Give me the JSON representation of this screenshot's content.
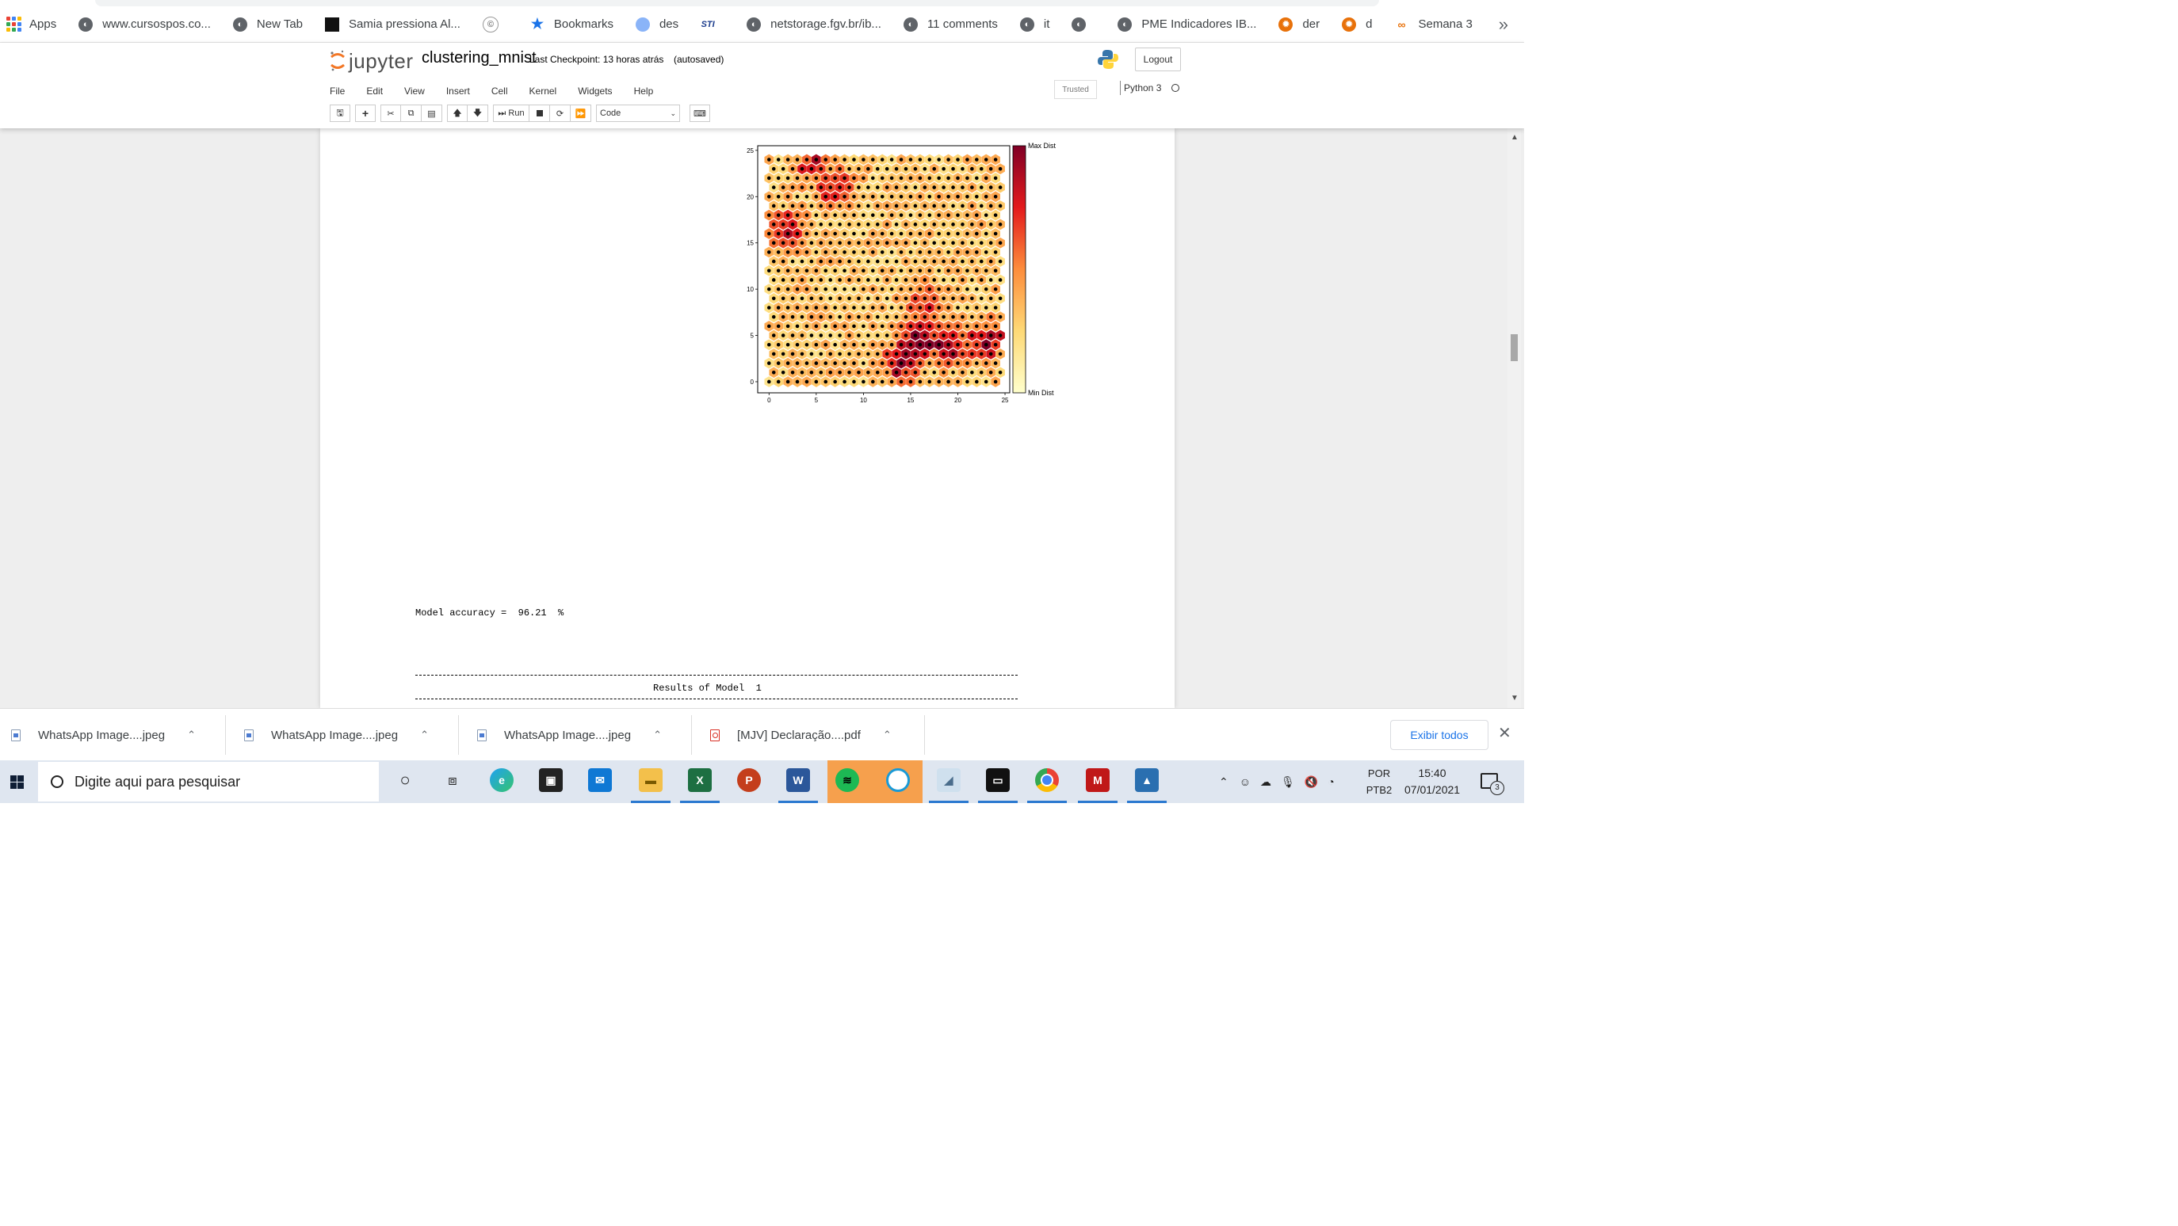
{
  "bookmarks": {
    "items": [
      {
        "label": "Apps",
        "icon": "apps-grid-icon"
      },
      {
        "label": "www.cursospos.co...",
        "icon": "globe-icon"
      },
      {
        "label": "New Tab",
        "icon": "globe-icon"
      },
      {
        "label": "Samia pressiona Al...",
        "icon": "news-icon"
      },
      {
        "label": "",
        "icon": "copyright-icon"
      },
      {
        "label": "Bookmarks",
        "icon": "star-icon"
      },
      {
        "label": "des",
        "icon": "circle-icon"
      },
      {
        "label": "",
        "icon": "sti-icon"
      },
      {
        "label": "netstorage.fgv.br/ib...",
        "icon": "globe-icon"
      },
      {
        "label": "11 comments",
        "icon": "globe-icon"
      },
      {
        "label": "it",
        "icon": "globe-icon"
      },
      {
        "label": "",
        "icon": "globe-icon"
      },
      {
        "label": "PME Indicadores IB...",
        "icon": "globe-icon"
      },
      {
        "label": "der",
        "icon": "gear-orange-icon"
      },
      {
        "label": "d",
        "icon": "gear-orange-icon"
      },
      {
        "label": "Semana 3",
        "icon": "colab-icon"
      }
    ],
    "more": "»",
    "sti_text": "STI"
  },
  "jupyter": {
    "logo_text": "jupyter",
    "notebook_name": "clustering_mnist",
    "checkpoint": "Last Checkpoint: 13 horas atrás",
    "autosave": "(autosaved)",
    "logout": "Logout",
    "menu": [
      "File",
      "Edit",
      "View",
      "Insert",
      "Cell",
      "Kernel",
      "Widgets",
      "Help"
    ],
    "trusted": "Trusted",
    "kernel": "Python 3",
    "run_label": "Run",
    "cell_type": "Code"
  },
  "output": {
    "accuracy_line": "Model accuracy =  96.21  %",
    "results_line": "Results of Model  1"
  },
  "chart_data": {
    "type": "heatmap",
    "title": "",
    "xlabel": "",
    "ylabel": "",
    "xlim": [
      -1.2,
      25.5
    ],
    "ylim": [
      -1.2,
      25.5
    ],
    "xticks": [
      "0",
      "5",
      "10",
      "15",
      "20",
      "25"
    ],
    "yticks": [
      "0",
      "5",
      "10",
      "15",
      "20",
      "25"
    ],
    "grid": "hexagonal 25x25 SOM nodes",
    "colorbar": {
      "max_label": "Max Dist",
      "min_label": "Min Dist",
      "colormap": "YlOrRd"
    },
    "node_color": "#000000",
    "high_distance_regions": [
      {
        "x": 16,
        "y": 4.5,
        "level": 0.9
      },
      {
        "x": 19,
        "y": 4,
        "level": 0.85
      },
      {
        "x": 23,
        "y": 4.5,
        "level": 0.9
      },
      {
        "x": 14,
        "y": 2,
        "level": 0.8
      },
      {
        "x": 2,
        "y": 16.5,
        "level": 0.8
      },
      {
        "x": 7,
        "y": 21,
        "level": 0.65
      },
      {
        "x": 16.5,
        "y": 8.5,
        "level": 0.6
      },
      {
        "x": 4.5,
        "y": 23.5,
        "level": 0.55
      }
    ]
  },
  "downloads": {
    "items": [
      {
        "name": "WhatsApp Image....jpeg",
        "type": "image"
      },
      {
        "name": "WhatsApp Image....jpeg",
        "type": "image"
      },
      {
        "name": "WhatsApp Image....jpeg",
        "type": "image"
      },
      {
        "name": "[MJV] Declaração....pdf",
        "type": "pdf"
      }
    ],
    "show_all": "Exibir todos"
  },
  "taskbar": {
    "search_placeholder": "Digite aqui para pesquisar",
    "lang_top": "POR",
    "lang_bottom": "PTB2",
    "time": "15:40",
    "date": "07/01/2021",
    "notifications": "3"
  }
}
